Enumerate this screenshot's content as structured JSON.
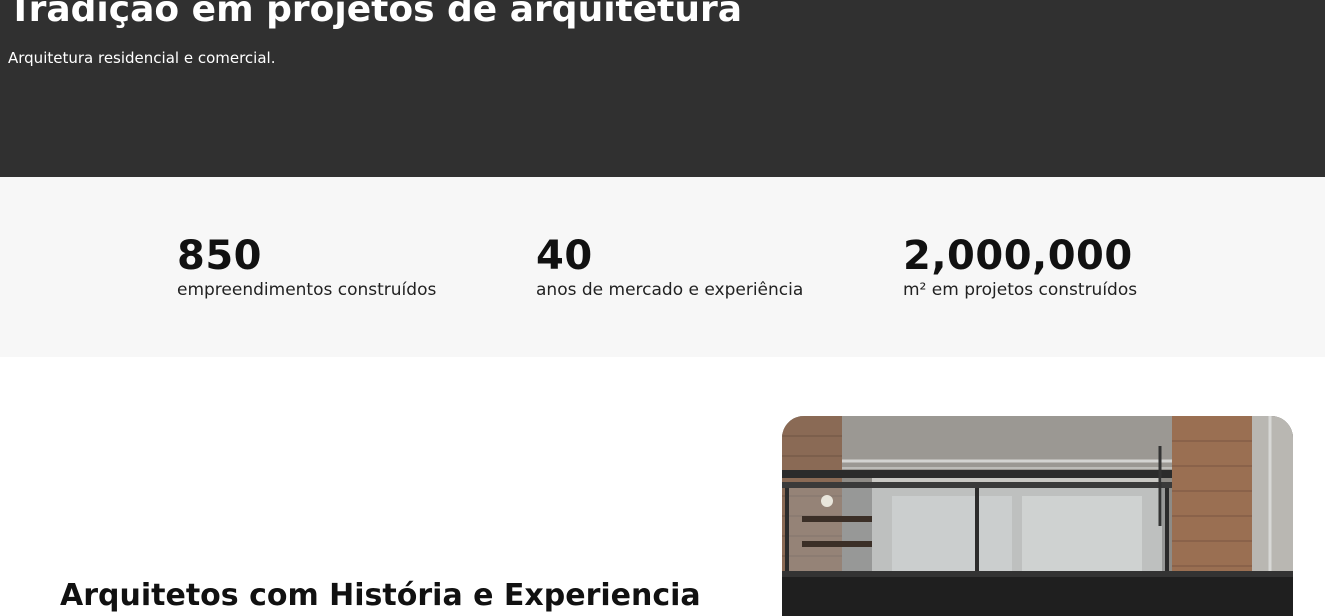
{
  "hero": {
    "title": "Tradição em projetos de arquitetura",
    "subtitle": "Arquitetura residencial e comercial."
  },
  "stats": [
    {
      "value": "850",
      "label": "empreendimentos construídos"
    },
    {
      "value": "40",
      "label": "anos de mercado e experiência"
    },
    {
      "value": "2,000,000",
      "label": "m² em projetos construídos"
    }
  ],
  "about": {
    "title": "Arquitetos com História e Experiencia"
  },
  "colors": {
    "hero_bg": "#303030",
    "stats_bg": "#f7f7f7",
    "text_dark": "#111111"
  }
}
